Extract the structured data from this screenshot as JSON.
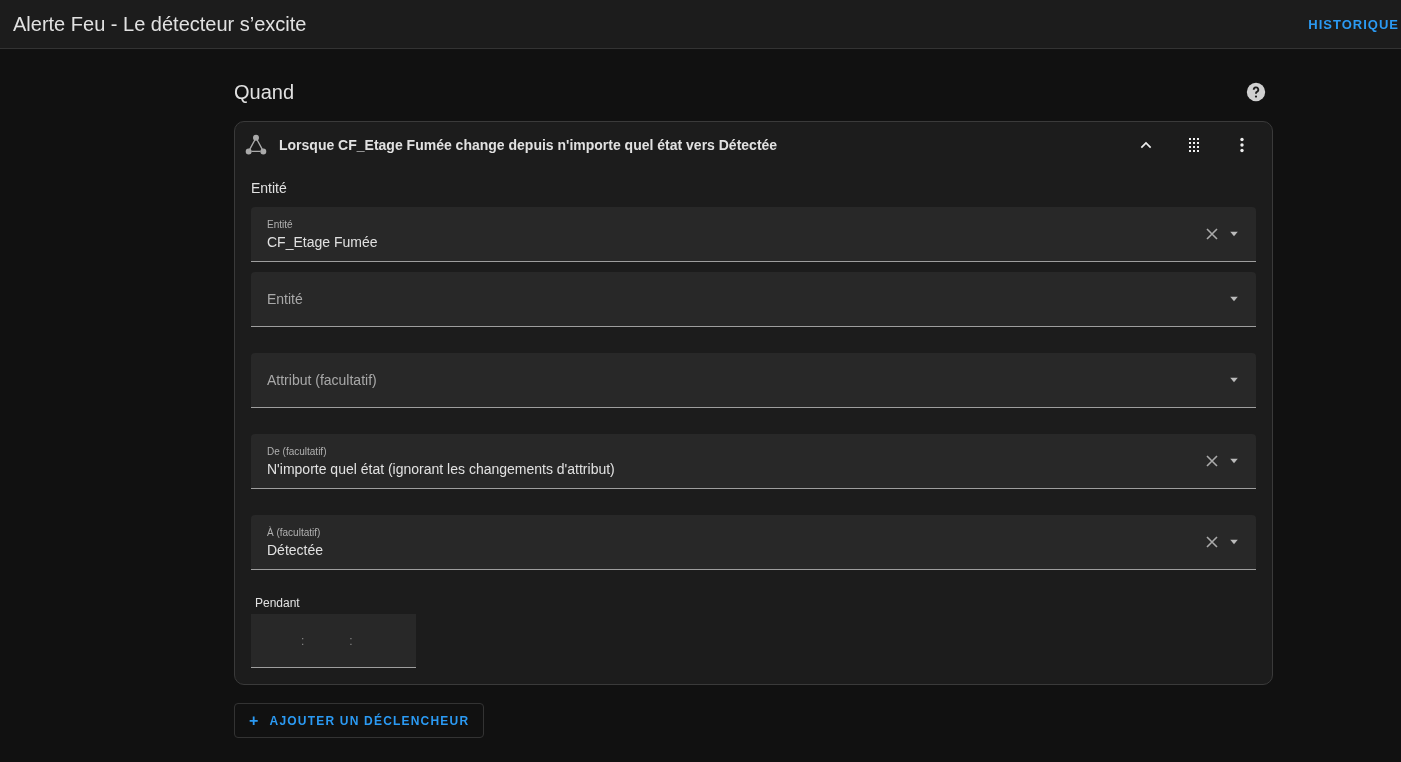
{
  "header": {
    "title": "Alerte Feu - Le détecteur s’excite",
    "action": "HISTORIQUE"
  },
  "section": {
    "title": "Quand"
  },
  "trigger": {
    "summary": "Lorsque CF_Etage Fumée change depuis n'importe quel état vers Détectée",
    "expanded": true,
    "group_label": "Entité",
    "fields": [
      {
        "label": "Entité",
        "value": "CF_Etage Fumée",
        "clearable": true
      },
      {
        "label": "Entité",
        "clearable": false
      },
      {
        "label": "Attribut (facultatif)",
        "clearable": false
      },
      {
        "label": "De (facultatif)",
        "value": "N'importe quel état (ignorant les changements d'attribut)",
        "clearable": true
      },
      {
        "label": "À (facultatif)",
        "value": "Détectée",
        "clearable": true
      }
    ],
    "duration": {
      "label": "Pendant",
      "separators": [
        ":",
        ":"
      ]
    }
  },
  "add_button": {
    "icon": "+",
    "label": "AJOUTER UN DÉCLENCHEUR"
  }
}
